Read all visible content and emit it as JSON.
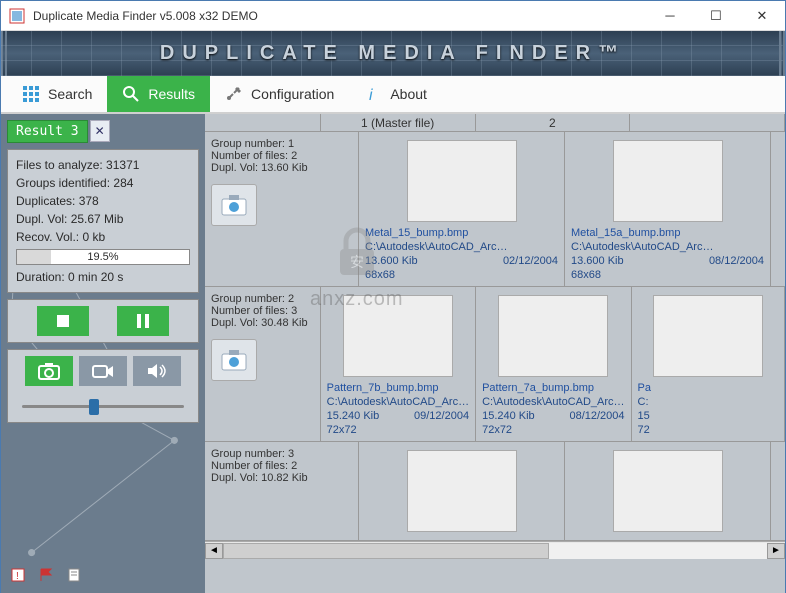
{
  "window": {
    "title": "Duplicate Media Finder  v5.008  x32  DEMO"
  },
  "brand": "DUPLICATE MEDIA FINDER™",
  "tabs": {
    "search": "Search",
    "results": "Results",
    "configuration": "Configuration",
    "about": "About"
  },
  "result_tab": {
    "label": "Result 3"
  },
  "stats": {
    "files": "Files to analyze: 31371",
    "groups": "Groups identified: 284",
    "duplicates": "Duplicates: 378",
    "dupl_vol": "Dupl. Vol: 25.67 Mib",
    "recov_vol": "Recov. Vol.: 0 kb",
    "progress_pct": "19.5%",
    "progress_val": 19.5,
    "duration": "Duration: 0 min  20 s"
  },
  "headers": {
    "col1": "1 (Master file)",
    "col2": "2"
  },
  "groups": [
    {
      "info": {
        "num": "Group number: 1",
        "files": "Number of files: 2",
        "vol": "Dupl. Vol: 13.60 Kib"
      },
      "cells": [
        {
          "name": "Metal_15_bump.bmp",
          "path": "C:\\Autodesk\\AutoCAD_Arc…",
          "size": "13.600 Kib",
          "date": "02/12/2004",
          "dim": "68x68",
          "pat": "pat-vstripes"
        },
        {
          "name": "Metal_15a_bump.bmp",
          "path": "C:\\Autodesk\\AutoCAD_Arc…",
          "size": "13.600 Kib",
          "date": "08/12/2004",
          "dim": "68x68",
          "pat": "pat-bars"
        }
      ]
    },
    {
      "info": {
        "num": "Group number: 2",
        "files": "Number of files: 3",
        "vol": "Dupl. Vol: 30.48 Kib"
      },
      "cells": [
        {
          "name": "Pattern_7b_bump.bmp",
          "path": "C:\\Autodesk\\AutoCAD_Arc…",
          "size": "15.240 Kib",
          "date": "09/12/2004",
          "dim": "72x72",
          "pat": "pat-hbars"
        },
        {
          "name": "Pattern_7a_bump.bmp",
          "path": "C:\\Autodesk\\AutoCAD_Arc…",
          "size": "15.240 Kib",
          "date": "08/12/2004",
          "dim": "72x72",
          "pat": "pat-hbars"
        },
        {
          "name": "Pa",
          "path": "C:",
          "size": "15",
          "date": "",
          "dim": "72",
          "pat": "pat-hbars"
        }
      ]
    },
    {
      "info": {
        "num": "Group number: 3",
        "files": "Number of files: 2",
        "vol": "Dupl. Vol: 10.82 Kib"
      },
      "cells": [
        {
          "name": "",
          "path": "",
          "size": "",
          "date": "",
          "dim": "",
          "pat": "pat-noise"
        },
        {
          "name": "",
          "path": "",
          "size": "",
          "date": "",
          "dim": "",
          "pat": "pat-noise"
        }
      ]
    }
  ],
  "watermark": "anxz.com"
}
